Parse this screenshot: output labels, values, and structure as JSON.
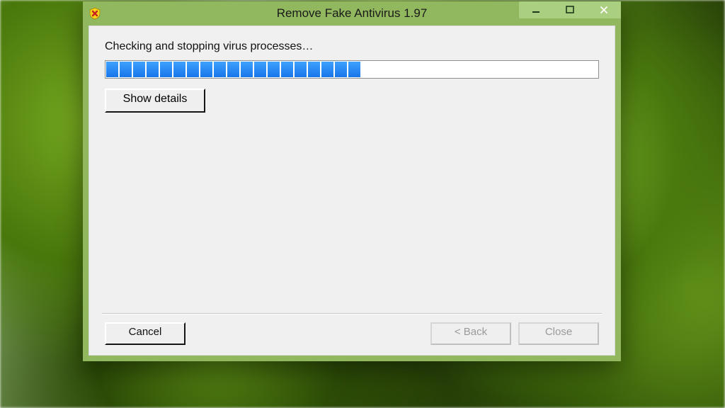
{
  "window": {
    "title": "Remove Fake Antivirus 1.97",
    "icon": "shield-x-icon"
  },
  "content": {
    "status": "Checking and stopping virus processes…",
    "progress_percent": 52,
    "show_details_label": "Show details"
  },
  "buttons": {
    "cancel": "Cancel",
    "back": "< Back",
    "close": "Close"
  },
  "colors": {
    "chrome": "#91b85e",
    "progress_chunk": "#1e86ff"
  }
}
